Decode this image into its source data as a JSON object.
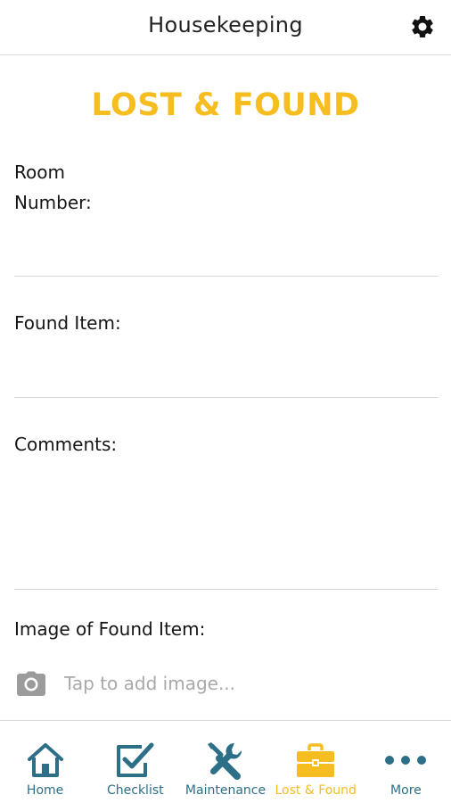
{
  "header": {
    "title": "Housekeeping",
    "settings_icon": "gear-icon"
  },
  "page_title": "LOST & FOUND",
  "form": {
    "room_number": {
      "label": "Room Number:",
      "value": ""
    },
    "found_item": {
      "label": "Found Item:",
      "value": ""
    },
    "comments": {
      "label": "Comments:",
      "value": ""
    },
    "image": {
      "label": "Image of Found Item:",
      "placeholder": "Tap to add image...",
      "icon": "camera-icon"
    }
  },
  "tabbar": {
    "tabs": [
      {
        "label": "Home",
        "icon": "home-icon",
        "active": false
      },
      {
        "label": "Checklist",
        "icon": "checklist-icon",
        "active": false
      },
      {
        "label": "Maintenance",
        "icon": "tools-icon",
        "active": false
      },
      {
        "label": "Lost & Found",
        "icon": "briefcase-icon",
        "active": true
      },
      {
        "label": "More",
        "icon": "more-icon",
        "active": false
      }
    ]
  },
  "colors": {
    "accent": "#f5bd1f",
    "nav": "#2d6f87",
    "placeholder": "#a9a9a9",
    "divider": "#d6d6d6"
  }
}
